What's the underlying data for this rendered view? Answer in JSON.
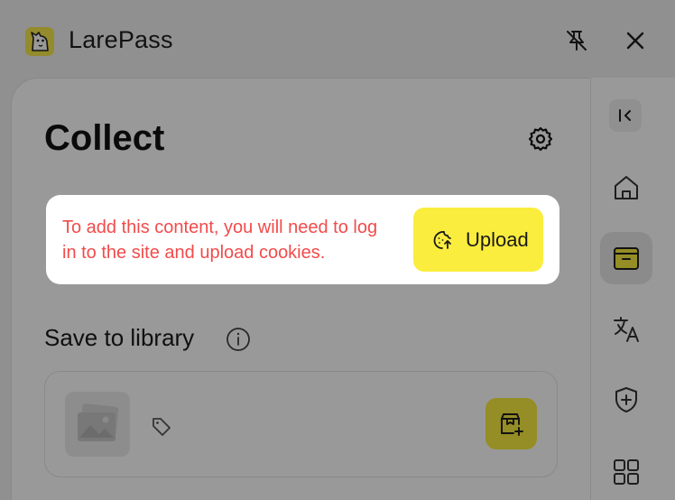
{
  "app": {
    "title": "LarePass"
  },
  "titlebar": {
    "pin_icon": "pin-off-icon",
    "close_icon": "close-icon"
  },
  "main": {
    "title": "Collect",
    "settings_icon": "gear-icon",
    "section_title": "Save to library",
    "info_icon": "info-icon",
    "item": {
      "thumbnail_icon": "image-placeholder-icon",
      "tag_icon": "tag-icon",
      "save_icon": "save-to-library-icon"
    }
  },
  "sidebar": {
    "items": [
      {
        "id": "collapse",
        "icon": "collapse-sidebar-icon"
      },
      {
        "id": "home",
        "icon": "home-icon"
      },
      {
        "id": "collect",
        "icon": "collect-box-icon",
        "active": true
      },
      {
        "id": "translate",
        "icon": "translate-icon"
      },
      {
        "id": "security",
        "icon": "shield-plus-icon"
      },
      {
        "id": "apps",
        "icon": "grid-icon"
      }
    ]
  },
  "notice": {
    "message": "To add this content, you will need to log in to the site and upload cookies.",
    "button_label": "Upload",
    "button_icon": "cookie-upload-icon"
  },
  "colors": {
    "accent": "#fbed3d",
    "warning_text": "#f24b4b",
    "overlay": "rgba(0,0,0,0.40)"
  }
}
